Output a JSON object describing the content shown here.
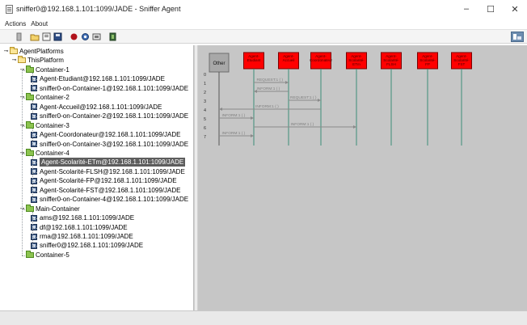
{
  "window": {
    "title": "sniffer0@192.168.1.101:1099/JADE - Sniffer Agent",
    "controls": {
      "minimize": "–",
      "maximize": "☐",
      "close": "✕"
    }
  },
  "menu": {
    "items": [
      "Actions",
      "About"
    ]
  },
  "toolbar": {
    "buttons": [
      {
        "name": "clear-icon"
      },
      {
        "name": "folder-open-icon"
      },
      {
        "name": "save-doc-icon"
      },
      {
        "name": "disk-icon"
      },
      {
        "name": "record-icon"
      },
      {
        "name": "filter-icon"
      },
      {
        "name": "message-icon"
      },
      {
        "name": "exit-icon"
      }
    ],
    "right_icon": "jade-icon"
  },
  "tree": {
    "nodes": [
      {
        "label": "AgentPlatforms",
        "kind": "folder-open",
        "level": 0
      },
      {
        "label": "ThisPlatform",
        "kind": "folder-open",
        "level": 1
      },
      {
        "label": "Container-1",
        "kind": "container",
        "level": 2
      },
      {
        "label": "Agent-Etudiant@192.168.1.101:1099/JADE",
        "kind": "agent",
        "level": 3
      },
      {
        "label": "sniffer0-on-Container-1@192.168.1.101:1099/JADE",
        "kind": "agent",
        "level": 3
      },
      {
        "label": "Container-2",
        "kind": "container",
        "level": 2
      },
      {
        "label": "Agent-Accueil@192.168.1.101:1099/JADE",
        "kind": "agent",
        "level": 3
      },
      {
        "label": "sniffer0-on-Container-2@192.168.1.101:1099/JADE",
        "kind": "agent",
        "level": 3
      },
      {
        "label": "Container-3",
        "kind": "container",
        "level": 2
      },
      {
        "label": "Agent-Coordonateur@192.168.1.101:1099/JADE",
        "kind": "agent",
        "level": 3
      },
      {
        "label": "sniffer0-on-Container-3@192.168.1.101:1099/JADE",
        "kind": "agent",
        "level": 3
      },
      {
        "label": "Container-4",
        "kind": "container",
        "level": 2
      },
      {
        "label": "Agent-Scolarité-ETm@192.168.1.101:1099/JADE",
        "kind": "agent",
        "level": 3,
        "selected": true
      },
      {
        "label": "Agent-Scolarité-FLSH@192.168.1.101:1099/JADE",
        "kind": "agent",
        "level": 3
      },
      {
        "label": "Agent-Scolarité-FP@192.168.1.101:1099/JADE",
        "kind": "agent",
        "level": 3
      },
      {
        "label": "Agent-Scolarité-FST@192.168.1.101:1099/JADE",
        "kind": "agent",
        "level": 3
      },
      {
        "label": "sniffer0-on-Container-4@192.168.1.101:1099/JADE",
        "kind": "agent",
        "level": 3
      },
      {
        "label": "Main-Container",
        "kind": "container",
        "level": 2
      },
      {
        "label": "ams@192.168.1.101:1099/JADE",
        "kind": "agent",
        "level": 3
      },
      {
        "label": "df@192.168.1.101:1099/JADE",
        "kind": "agent",
        "level": 3
      },
      {
        "label": "rma@192.168.1.101:1099/JADE",
        "kind": "agent",
        "level": 3
      },
      {
        "label": "sniffer0@192.168.1.101:1099/JADE",
        "kind": "agent",
        "level": 3
      },
      {
        "label": "Container-5",
        "kind": "container",
        "level": 2
      }
    ]
  },
  "sniffer": {
    "other_label": "Other",
    "agent_boxes": [
      {
        "label": "Agent-Etudiant",
        "color": "#ff0000"
      },
      {
        "label": "Agent-Accueil",
        "color": "#ff0000"
      },
      {
        "label": "Agent-Coordonateur",
        "color": "#ff0000"
      },
      {
        "label": "Agent-Scolarité-ETm",
        "color": "#ff0000"
      },
      {
        "label": "Agent-Scolarité-FLSH",
        "color": "#ff0000"
      },
      {
        "label": "Agent-Scolarité-FP",
        "color": "#ff0000"
      },
      {
        "label": "Agent-Scolarité-FST",
        "color": "#ff0000"
      }
    ],
    "row_numbers": [
      "0",
      "1",
      "2",
      "3",
      "4",
      "5",
      "6",
      "7"
    ],
    "messages": [
      {
        "label": "REQUEST:1 ( )",
        "from": 1,
        "to": 2
      },
      {
        "label": "INFORM:1 ( )",
        "from": 2,
        "to": 1
      },
      {
        "label": "REQUEST:1 ( )",
        "from": 2,
        "to": 3
      },
      {
        "label": "INFORM:1 ( )",
        "from": 3,
        "to": 0
      },
      {
        "label": "INFORM:1 ( )",
        "from": 0,
        "to": 1
      },
      {
        "label": "INFORM:1 ( )",
        "from": 1,
        "to": 4
      },
      {
        "label": "INFORM:1 ( )",
        "from": 0,
        "to": 1
      }
    ],
    "lifeline_color": "#3c8f78",
    "arrow_color": "#8a8a8a"
  }
}
